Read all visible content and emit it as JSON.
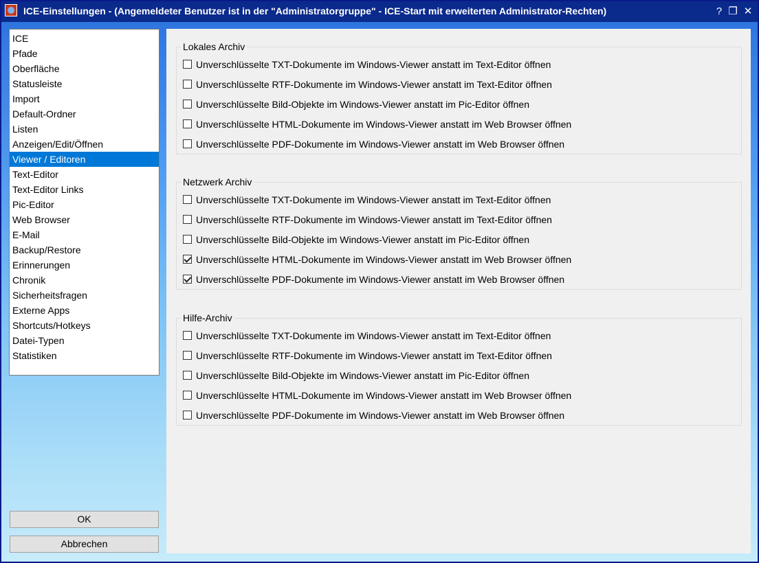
{
  "window": {
    "title": "ICE-Einstellungen - (Angemeldeter Benutzer ist in der \"Administratorgruppe\" - ICE-Start mit erweiterten Administrator-Rechten)",
    "help_glyph": "?",
    "restore_glyph": "❐",
    "close_glyph": "✕",
    "icon": "app-icon"
  },
  "sidebar": {
    "selected_index": 8,
    "items": [
      {
        "label": "ICE"
      },
      {
        "label": "Pfade"
      },
      {
        "label": "Oberfläche"
      },
      {
        "label": "Statusleiste"
      },
      {
        "label": "Import"
      },
      {
        "label": "Default-Ordner"
      },
      {
        "label": "Listen"
      },
      {
        "label": "Anzeigen/Edit/Öffnen"
      },
      {
        "label": "Viewer / Editoren"
      },
      {
        "label": "Text-Editor"
      },
      {
        "label": "Text-Editor Links"
      },
      {
        "label": "Pic-Editor"
      },
      {
        "label": "Web Browser"
      },
      {
        "label": "E-Mail"
      },
      {
        "label": "Backup/Restore"
      },
      {
        "label": "Erinnerungen"
      },
      {
        "label": "Chronik"
      },
      {
        "label": "Sicherheitsfragen"
      },
      {
        "label": "Externe Apps"
      },
      {
        "label": "Shortcuts/Hotkeys"
      },
      {
        "label": "Datei-Typen"
      },
      {
        "label": "Statistiken"
      }
    ]
  },
  "buttons": {
    "ok_label": "OK",
    "cancel_label": "Abbrechen"
  },
  "groups": [
    {
      "title": "Lokales Archiv",
      "options": [
        {
          "label": "Unverschlüsselte TXT-Dokumente im Windows-Viewer anstatt im Text-Editor öffnen",
          "checked": false
        },
        {
          "label": "Unverschlüsselte RTF-Dokumente im Windows-Viewer anstatt im Text-Editor öffnen",
          "checked": false
        },
        {
          "label": "Unverschlüsselte Bild-Objekte im Windows-Viewer anstatt im Pic-Editor öffnen",
          "checked": false
        },
        {
          "label": "Unverschlüsselte HTML-Dokumente im Windows-Viewer anstatt im Web Browser öffnen",
          "checked": false
        },
        {
          "label": "Unverschlüsselte PDF-Dokumente im Windows-Viewer anstatt im Web Browser öffnen",
          "checked": false
        }
      ]
    },
    {
      "title": "Netzwerk Archiv",
      "options": [
        {
          "label": "Unverschlüsselte TXT-Dokumente im Windows-Viewer anstatt im Text-Editor öffnen",
          "checked": false
        },
        {
          "label": "Unverschlüsselte RTF-Dokumente im Windows-Viewer anstatt im Text-Editor öffnen",
          "checked": false
        },
        {
          "label": "Unverschlüsselte Bild-Objekte im Windows-Viewer anstatt im Pic-Editor öffnen",
          "checked": false
        },
        {
          "label": "Unverschlüsselte HTML-Dokumente im Windows-Viewer anstatt im Web Browser öffnen",
          "checked": true
        },
        {
          "label": "Unverschlüsselte PDF-Dokumente im Windows-Viewer anstatt im Web Browser öffnen",
          "checked": true
        }
      ]
    },
    {
      "title": "Hilfe-Archiv",
      "options": [
        {
          "label": "Unverschlüsselte TXT-Dokumente im Windows-Viewer anstatt im Text-Editor öffnen",
          "checked": false
        },
        {
          "label": "Unverschlüsselte RTF-Dokumente im Windows-Viewer anstatt im Text-Editor öffnen",
          "checked": false
        },
        {
          "label": "Unverschlüsselte Bild-Objekte im Windows-Viewer anstatt im Pic-Editor öffnen",
          "checked": false
        },
        {
          "label": "Unverschlüsselte HTML-Dokumente im Windows-Viewer anstatt im Web Browser öffnen",
          "checked": false
        },
        {
          "label": "Unverschlüsselte PDF-Dokumente im Windows-Viewer anstatt im Web Browser öffnen",
          "checked": false
        }
      ]
    }
  ]
}
